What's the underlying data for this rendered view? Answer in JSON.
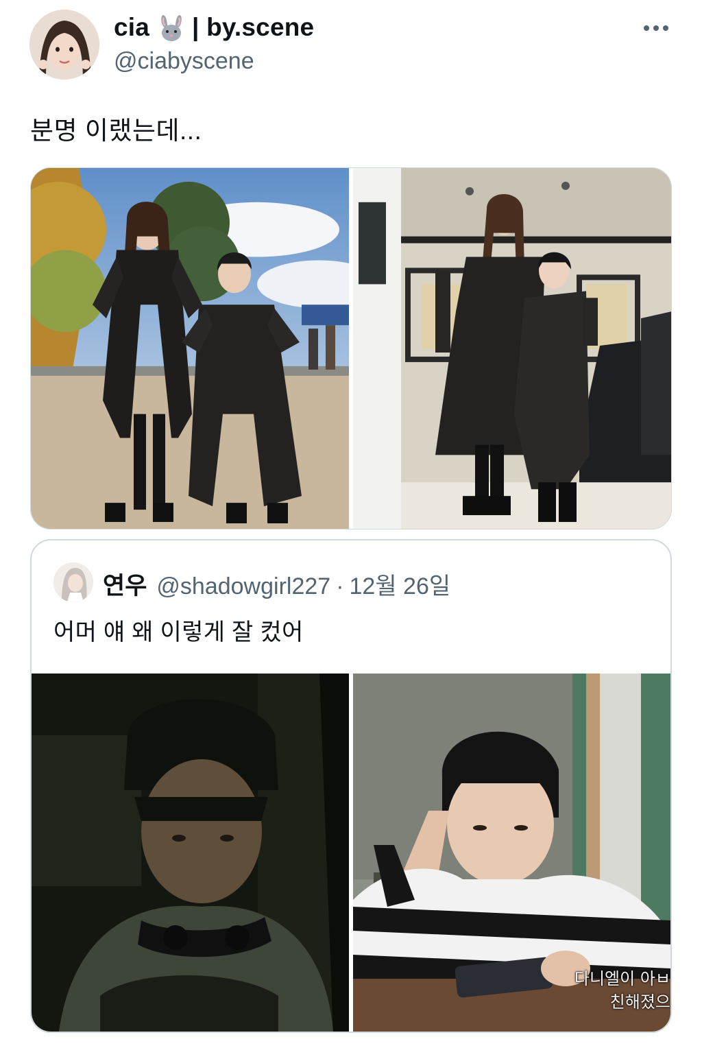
{
  "tweet": {
    "display_name": "cia",
    "name_suffix": "| by.scene",
    "handle": "@ciabyscene",
    "text": "분명 이랬는데...",
    "icons": {
      "avatar": "profile-photo",
      "name_emoji": "rabbit-face-icon",
      "more": "more-options-icon"
    },
    "media": [
      {
        "name": "photo-outdoor-leather-coats"
      },
      {
        "name": "photo-van-leather-coats"
      }
    ]
  },
  "quoted_tweet": {
    "display_name": "연우",
    "handle": "@shadowgirl227",
    "separator": "·",
    "date": "12월 26일",
    "text": "어머 얘 왜 이렇게 잘 컸어",
    "media": [
      {
        "name": "still-boy-in-car"
      },
      {
        "name": "still-boy-striped-shirt"
      }
    ],
    "subtitle": "다니엘이 아ㅂ\n친해졌으"
  },
  "colors": {
    "text": "#0f1419",
    "secondary": "#536471",
    "border": "#cfd9de"
  }
}
